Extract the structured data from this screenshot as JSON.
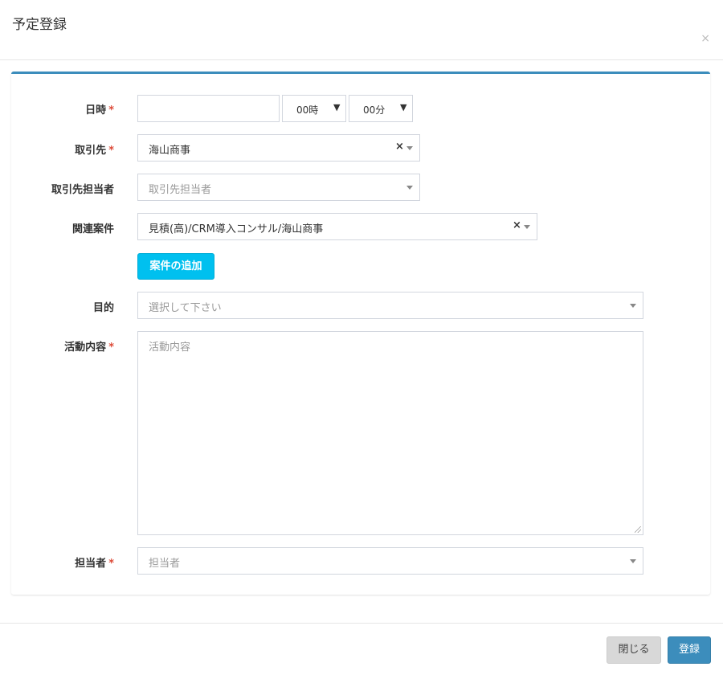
{
  "modal": {
    "title": "予定登録",
    "close_icon": "×"
  },
  "form": {
    "datetime": {
      "label": "日時",
      "required_mark": "*",
      "date_value": "",
      "hour_value": "00時",
      "minute_value": "00分",
      "select_arrow": "▼"
    },
    "client": {
      "label": "取引先",
      "required_mark": "*",
      "value": "海山商事",
      "clear_icon": "×"
    },
    "client_contact": {
      "label": "取引先担当者",
      "placeholder": "取引先担当者"
    },
    "related_deal": {
      "label": "関連案件",
      "value": "見積(高)/CRM導入コンサル/海山商事",
      "clear_icon": "×",
      "add_button_label": "案件の追加"
    },
    "purpose": {
      "label": "目的",
      "placeholder": "選択して下さい"
    },
    "activity": {
      "label": "活動内容",
      "required_mark": "*",
      "placeholder": "活動内容"
    },
    "assignee": {
      "label": "担当者",
      "required_mark": "*",
      "placeholder": "担当者"
    }
  },
  "footer": {
    "close_label": "閉じる",
    "submit_label": "登録"
  },
  "colors": {
    "primary": "#3c8dbc",
    "info": "#00c0ef",
    "required": "#dd4b39"
  }
}
